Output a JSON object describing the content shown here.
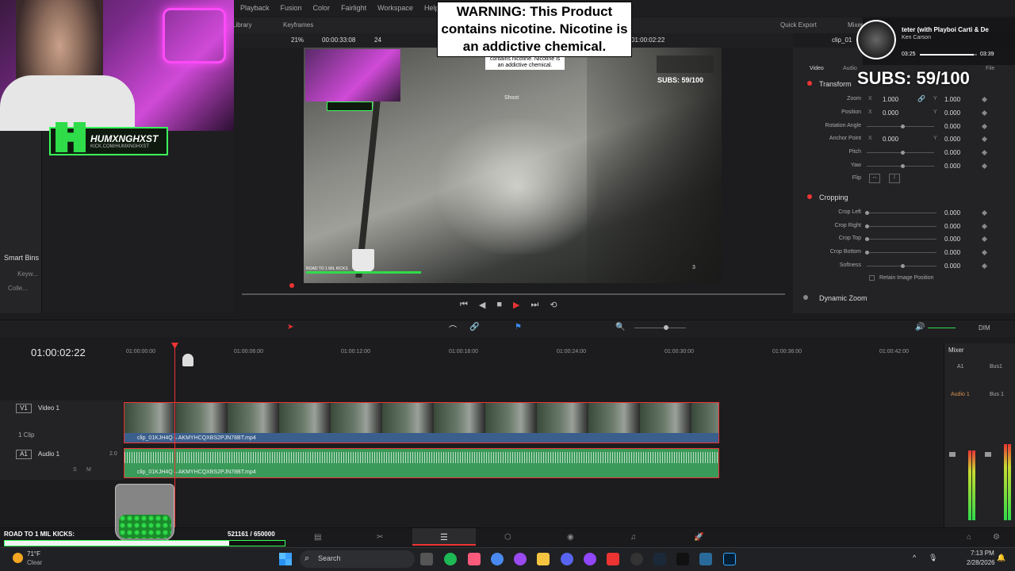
{
  "menu": [
    "Playback",
    "Fusion",
    "Color",
    "Fairlight",
    "Workspace",
    "Help"
  ],
  "subbar": {
    "library": "Library",
    "keyframes": "Keyframes",
    "quick_export": "Quick Export",
    "mixer": "Mixer"
  },
  "viewer_bar": {
    "zoom": "21%",
    "source_timecode": "00:00:33:08",
    "fps": "24",
    "timecode": "01:00:02:22",
    "clip_name": "clip_01"
  },
  "warning": {
    "text": "WARNING: This Product contains nicotine. Nicotine is an addictive chemical.",
    "small": "contains nicotine. Nicotine is an addictive chemical."
  },
  "webcam_overlay": {
    "brand": "HUMXNGHXST",
    "url": "KICK.COM/HUMXNGHXST"
  },
  "viewer": {
    "shoot": "Shoot",
    "subs": "SUBS: 59/100",
    "ammo": "3",
    "road": "ROAD TO 1 MIL KICKS"
  },
  "now_playing": {
    "title": "teter (with Playboi Carti & De",
    "artist": "Ken Carson",
    "elapsed": "03:25",
    "total": "03:39",
    "progress": 0.94
  },
  "subs_counter": "SUBS: 59/100",
  "inspector": {
    "tabs": {
      "video": "Video",
      "audio": "Audio",
      "file": "File"
    },
    "transform": {
      "title": "Transform",
      "zoom": {
        "label": "Zoom",
        "x": "1.000",
        "y": "1.000"
      },
      "position": {
        "label": "Position",
        "x": "0.000",
        "y": "0.000"
      },
      "rotation": {
        "label": "Rotation Angle",
        "value": "0.000"
      },
      "anchor": {
        "label": "Anchor Point",
        "x": "0.000",
        "y": "0.000"
      },
      "pitch": {
        "label": "Pitch",
        "value": "0.000"
      },
      "yaw": {
        "label": "Yaw",
        "value": "0.000"
      },
      "flip": {
        "label": "Flip"
      }
    },
    "cropping": {
      "title": "Cropping",
      "left": {
        "label": "Crop Left",
        "value": "0.000"
      },
      "right": {
        "label": "Crop Right",
        "value": "0.000"
      },
      "top": {
        "label": "Crop Top",
        "value": "0.000"
      },
      "bottom": {
        "label": "Crop Bottom",
        "value": "0.000"
      },
      "softness": {
        "label": "Softness",
        "value": "0.000"
      },
      "retain": "Retain Image Position"
    },
    "dynamic_zoom": "Dynamic Zoom"
  },
  "left_panel": {
    "smart_bins": "Smart Bins",
    "keywords": "Keyw...",
    "collections": "Colle..."
  },
  "timeline": {
    "timecode": "01:00:02:22",
    "ticks": [
      "01:00:00:00",
      "01:00:06:00",
      "01:00:12:00",
      "01:00:18:00",
      "01:00:24:00",
      "01:00:30:00",
      "01:00:36:00",
      "01:00:42:00"
    ],
    "video_track": {
      "tag": "V1",
      "name": "Video 1",
      "clips": "1 Clip",
      "clip_name": "clip_01KJH4Q→AKMYHCQXBS2PJN78BT.mp4"
    },
    "audio_track": {
      "tag": "A1",
      "name": "Audio 1",
      "level": "2.0",
      "clip_name": "clip_01KJH4Q→AKMYHCQXBS2PJN78BT.mp4"
    },
    "dim": "DIM"
  },
  "mixer": {
    "title": "Mixer",
    "a1": "A1",
    "bus1": "Bus1",
    "audio1": "Audio 1",
    "bus1b": "Bus 1"
  },
  "stream_overlay": {
    "road_label": "ROAD TO 1 MIL KICKS:",
    "count": "521161",
    "goal": "/ 650000",
    "progress": 0.8018
  },
  "taskbar": {
    "weather_temp": "71°F",
    "weather_desc": "Clear",
    "search": "Search",
    "time": "7:13 PM",
    "date": "2/28/2026"
  },
  "colors": {
    "accent_red": "#e33333",
    "kick_green": "#3aff5a",
    "video_clip": "#3a5f8c",
    "audio_clip": "#3a9a5a"
  }
}
